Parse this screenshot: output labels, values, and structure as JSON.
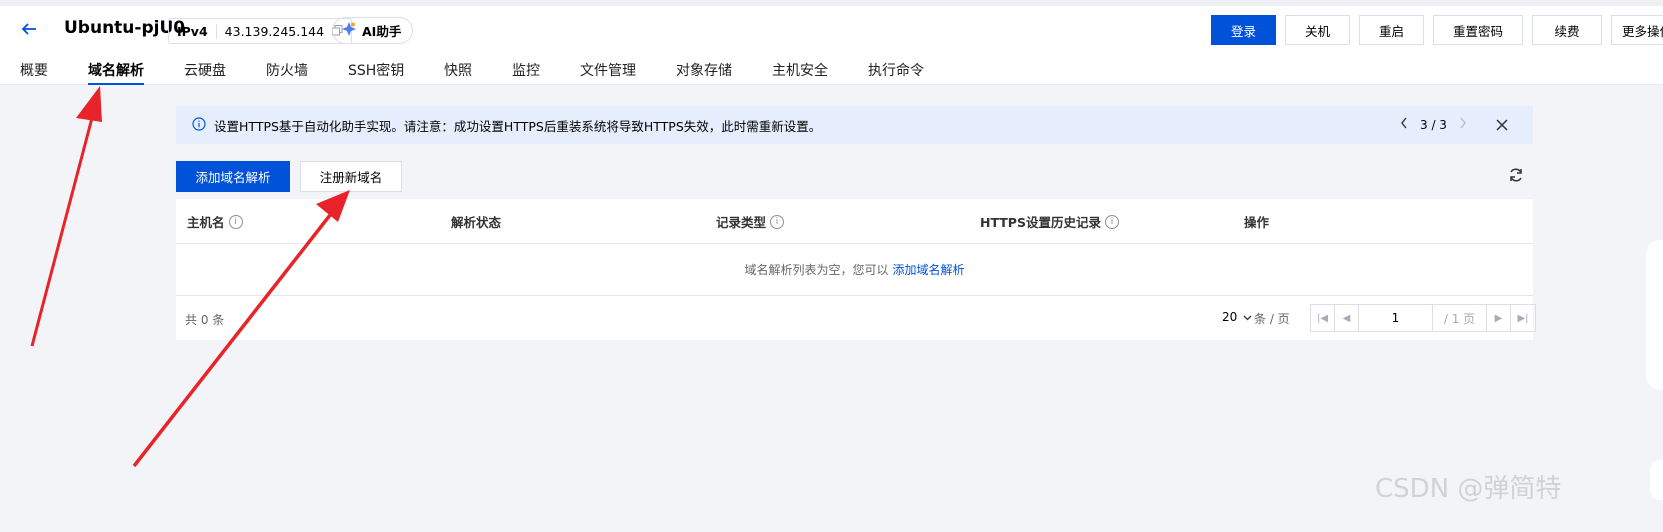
{
  "header": {
    "instance_name": "Ubuntu-pjU0",
    "ip_type": "IPv4",
    "ip_address": "43.139.245.144",
    "ai_label": "AI助手"
  },
  "actions": {
    "login": "登录",
    "shutdown": "关机",
    "restart": "重启",
    "reset_password": "重置密码",
    "renew": "续费",
    "more": "更多操作"
  },
  "tabs": [
    "概要",
    "域名解析",
    "云硬盘",
    "防火墙",
    "SSH密钥",
    "快照",
    "监控",
    "文件管理",
    "对象存储",
    "主机安全",
    "执行命令"
  ],
  "active_tab": "域名解析",
  "notice": {
    "text": "设置HTTPS基于自动化助手实现。请注意：成功设置HTTPS后重装系统将导致HTTPS失效，此时需重新设置。",
    "pager": "3 / 3"
  },
  "toolbar": {
    "add_record": "添加域名解析",
    "register_domain": "注册新域名"
  },
  "table": {
    "columns": [
      "主机名",
      "解析状态",
      "记录类型",
      "HTTPS设置历史记录",
      "操作"
    ],
    "empty_text": "域名解析列表为空，您可以",
    "empty_link": "添加域名解析",
    "total": "共 0 条",
    "page_size": "20",
    "page_unit": "条 / 页",
    "page_input": "1",
    "page_of": "/ 1 页"
  },
  "watermark": "CSDN @弹简特",
  "colors": {
    "primary": "#0052d9",
    "notice_bg": "#e6eefd",
    "arrow": "#e8232a"
  }
}
